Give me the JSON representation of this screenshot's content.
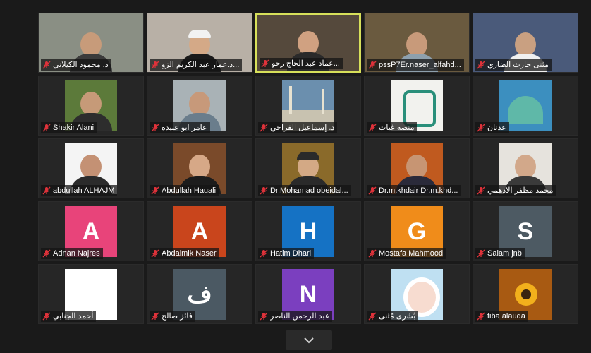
{
  "gallery": {
    "tiles": [
      {
        "name": "د. محمود الكيلاني",
        "type": "video",
        "bg": "#8a8f84",
        "skin": "#c79b7a",
        "shirt": "#3b3b3b"
      },
      {
        "name": "د.عمار عبد الكريم الزو...",
        "type": "video",
        "bg": "#b8b0a6",
        "skin": "#d4a987",
        "shirt": "#1a1a1a",
        "hat": "#f2f2f2"
      },
      {
        "name": "عماد عبد الحاج رحو...",
        "type": "video",
        "bg": "#55493c",
        "skin": "#d0a181",
        "shirt": "#2a2a2a",
        "active": true
      },
      {
        "name": "pssP7Er.naser_alfahd...",
        "type": "video",
        "bg": "#6a5a3f",
        "skin": "#c89a7a",
        "shirt": "#8ea0ad"
      },
      {
        "name": "مثنى حارث الضاري",
        "type": "video",
        "bg": "#4a5a7a",
        "skin": "#c9a081",
        "shirt": "#f0f0f0"
      },
      {
        "name": "Shakir Alani",
        "type": "photo",
        "bg": "#5c7a3a",
        "skin": "#c69a78",
        "shirt": "#2d2d2d"
      },
      {
        "name": "عامر ابو عبيدة",
        "type": "photo",
        "bg": "#a9b2b6",
        "skin": "#c7997a",
        "shirt": "#6a7d8c"
      },
      {
        "name": "د. إسماعيل الفراجي",
        "type": "photo",
        "bg": "#6b8fae",
        "skin": "",
        "shirt": "",
        "scene": "mosque"
      },
      {
        "name": "منصة غياث",
        "type": "photo",
        "bg": "#f2f2ee",
        "skin": "",
        "shirt": "",
        "scene": "calligraphy"
      },
      {
        "name": "عدنان",
        "type": "photo",
        "bg": "#3c8fbf",
        "skin": "",
        "shirt": "",
        "scene": "dome"
      },
      {
        "name": "abdullah ALHAJM",
        "type": "photo",
        "bg": "#f4f4f4",
        "skin": "#c49174",
        "shirt": "#2b2b2b"
      },
      {
        "name": "Abdullah Hauali",
        "type": "photo",
        "bg": "#7a4a2a",
        "skin": "#d6a887",
        "shirt": "#1c1c1c"
      },
      {
        "name": "Dr.Mohamad obeidal...",
        "type": "photo",
        "bg": "#8a6a2a",
        "skin": "#d3a985",
        "shirt": "#2a2a2a",
        "hat": "#2a2a2a"
      },
      {
        "name": "Dr.m.khdair Dr.m.khd...",
        "type": "photo",
        "bg": "#c05a1f",
        "skin": "#c79573",
        "shirt": "#2a2a3a"
      },
      {
        "name": "محمد مظفر الادهمي",
        "type": "photo",
        "bg": "#e6e3dd",
        "skin": "#d2a88a",
        "shirt": "#3a3a3a"
      },
      {
        "name": "Adnan Najres",
        "type": "letter",
        "letter": "A",
        "color": "#e8447a"
      },
      {
        "name": "Abdalmlk Naser",
        "type": "letter",
        "letter": "A",
        "color": "#c9451c"
      },
      {
        "name": "Hatim Dhari",
        "type": "letter",
        "letter": "H",
        "color": "#1572c4"
      },
      {
        "name": "Mostafa Mahmood",
        "type": "letter",
        "letter": "G",
        "color": "#f08c1a"
      },
      {
        "name": "Salam jnb",
        "type": "letter",
        "letter": "S",
        "color": "#4d5a63"
      },
      {
        "name": "أحمد الجنابي",
        "type": "letter",
        "letter": "",
        "color": "#ffffff"
      },
      {
        "name": "فائز صالح",
        "type": "letter",
        "letter": "ف",
        "color": "#4b5963"
      },
      {
        "name": "عبد الرحمن الناصر",
        "type": "letter",
        "letter": "N",
        "color": "#7b3fbf"
      },
      {
        "name": "بُشرى مُثنى",
        "type": "photo",
        "bg": "#bfe0f2",
        "skin": "",
        "shirt": "",
        "scene": "cartoon"
      },
      {
        "name": "tiba alauda",
        "type": "photo",
        "bg": "#a85a12",
        "skin": "",
        "shirt": "",
        "scene": "sunflower"
      }
    ]
  },
  "controls": {
    "expand_icon": "chevron-down-icon"
  },
  "colors": {
    "active_border": "#d7e05a",
    "muted_mic": "#e0323a",
    "background": "#1a1a1a"
  }
}
